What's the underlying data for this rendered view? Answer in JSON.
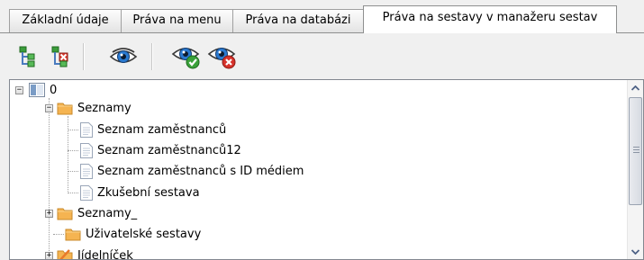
{
  "tabs": [
    {
      "label": "Základní údaje",
      "active": false
    },
    {
      "label": "Práva na menu",
      "active": false
    },
    {
      "label": "Práva na databázi",
      "active": false
    },
    {
      "label": "Práva na sestavy v manažeru sestav",
      "active": true
    }
  ],
  "toolbar": {
    "buttons": [
      {
        "name": "expand-tree",
        "icon": "tree-add-icon"
      },
      {
        "name": "collapse-tree",
        "icon": "tree-remove-icon"
      },
      {
        "name": "view",
        "icon": "eye-icon"
      },
      {
        "name": "view-allow",
        "icon": "eye-check-icon"
      },
      {
        "name": "view-deny",
        "icon": "eye-deny-icon"
      }
    ]
  },
  "tree": {
    "root": {
      "label": "0",
      "expanded": true
    },
    "nodes": [
      {
        "label": "Seznamy",
        "type": "folder",
        "level": 1,
        "expanded": true
      },
      {
        "label": "Seznam zaměstnanců",
        "type": "report",
        "level": 2
      },
      {
        "label": "Seznam zaměstnanců12",
        "type": "report",
        "level": 2
      },
      {
        "label": "Seznam zaměstnanců s ID médiem",
        "type": "report",
        "level": 2
      },
      {
        "label": "Zkušební sestava",
        "type": "report",
        "level": 2
      },
      {
        "label": "Seznamy_",
        "type": "folder",
        "level": 1,
        "expanded": false
      },
      {
        "label": "Uživatelské sestavy",
        "type": "folder",
        "level": 1
      },
      {
        "label": "Jídelníček",
        "type": "folder",
        "level": 1,
        "expanded": false
      }
    ]
  },
  "colors": {
    "folder": "#f5b451",
    "accent_blue": "#2a7ad1",
    "allow_green": "#3aa13a",
    "deny_red": "#d6322b"
  }
}
